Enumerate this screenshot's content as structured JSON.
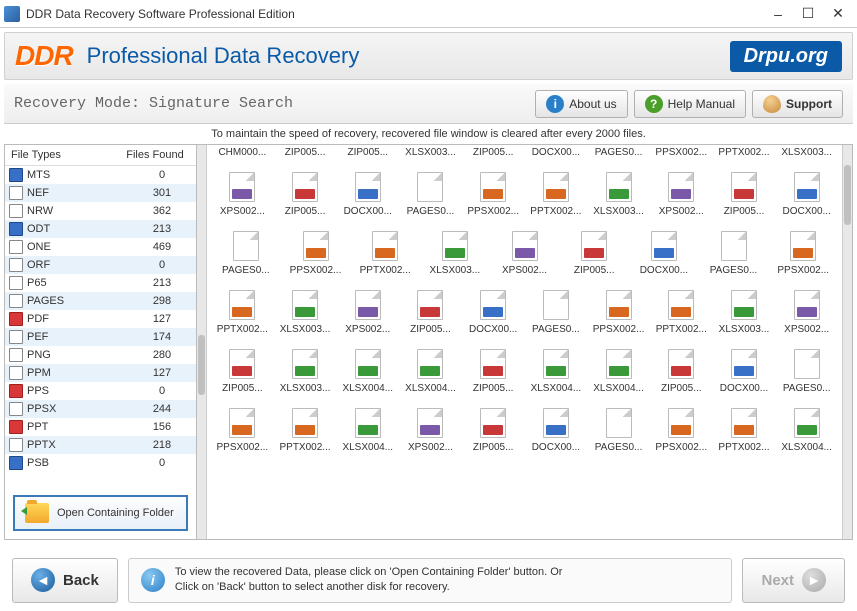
{
  "window": {
    "title": "DDR Data Recovery Software Professional Edition"
  },
  "banner": {
    "logo": "DDR",
    "title": "Professional Data Recovery",
    "brand": "Drpu.org"
  },
  "toolbar": {
    "mode": "Recovery Mode: Signature Search",
    "about": "About us",
    "help": "Help Manual",
    "support": "Support"
  },
  "info_strip": "To maintain the speed of recovery, recovered file window is cleared after every 2000 files.",
  "filetypes": {
    "col1": "File Types",
    "col2": "Files Found",
    "rows": [
      {
        "name": "MTS",
        "count": "0",
        "ic": "blue"
      },
      {
        "name": "NEF",
        "count": "301",
        "ic": ""
      },
      {
        "name": "NRW",
        "count": "362",
        "ic": ""
      },
      {
        "name": "ODT",
        "count": "213",
        "ic": "blue"
      },
      {
        "name": "ONE",
        "count": "469",
        "ic": ""
      },
      {
        "name": "ORF",
        "count": "0",
        "ic": ""
      },
      {
        "name": "P65",
        "count": "213",
        "ic": ""
      },
      {
        "name": "PAGES",
        "count": "298",
        "ic": ""
      },
      {
        "name": "PDF",
        "count": "127",
        "ic": "red"
      },
      {
        "name": "PEF",
        "count": "174",
        "ic": ""
      },
      {
        "name": "PNG",
        "count": "280",
        "ic": ""
      },
      {
        "name": "PPM",
        "count": "127",
        "ic": ""
      },
      {
        "name": "PPS",
        "count": "0",
        "ic": "red"
      },
      {
        "name": "PPSX",
        "count": "244",
        "ic": ""
      },
      {
        "name": "PPT",
        "count": "156",
        "ic": "red"
      },
      {
        "name": "PPTX",
        "count": "218",
        "ic": ""
      },
      {
        "name": "PSB",
        "count": "0",
        "ic": "blue"
      }
    ]
  },
  "open_folder": "Open Containing Folder",
  "grid": {
    "top": [
      "CHM000...",
      "ZIP005...",
      "ZIP005...",
      "XLSX003...",
      "ZIP005...",
      "DOCX00...",
      "PAGES0...",
      "PPSX002...",
      "PPTX002...",
      "XLSX003..."
    ],
    "rows": [
      [
        {
          "l": "XPS002...",
          "t": "xps"
        },
        {
          "l": "ZIP005...",
          "t": "zip"
        },
        {
          "l": "DOCX00...",
          "t": "doc"
        },
        {
          "l": "PAGES0...",
          "t": ""
        },
        {
          "l": "PPSX002...",
          "t": "ppt"
        },
        {
          "l": "PPTX002...",
          "t": "ppt"
        },
        {
          "l": "XLSX003...",
          "t": "xls"
        },
        {
          "l": "XPS002...",
          "t": "xps"
        },
        {
          "l": "ZIP005...",
          "t": "zip"
        },
        {
          "l": "DOCX00...",
          "t": "doc"
        }
      ],
      [
        {
          "l": "PAGES0...",
          "t": ""
        },
        {
          "l": "PPSX002...",
          "t": "ppt"
        },
        {
          "l": "PPTX002...",
          "t": "ppt"
        },
        {
          "l": "XLSX003...",
          "t": "xls"
        },
        {
          "l": "XPS002...",
          "t": "xps"
        },
        {
          "l": "ZIP005...",
          "t": "zip"
        },
        {
          "l": "DOCX00...",
          "t": "doc"
        },
        {
          "l": "PAGES0...",
          "t": ""
        },
        {
          "l": "PPSX002...",
          "t": "ppt"
        }
      ],
      [
        {
          "l": "PPTX002...",
          "t": "ppt"
        },
        {
          "l": "XLSX003...",
          "t": "xls"
        },
        {
          "l": "XPS002...",
          "t": "xps"
        },
        {
          "l": "ZIP005...",
          "t": "zip"
        },
        {
          "l": "DOCX00...",
          "t": "doc"
        },
        {
          "l": "PAGES0...",
          "t": ""
        },
        {
          "l": "PPSX002...",
          "t": "ppt"
        },
        {
          "l": "PPTX002...",
          "t": "ppt"
        },
        {
          "l": "XLSX003...",
          "t": "xls"
        },
        {
          "l": "XPS002...",
          "t": "xps"
        }
      ],
      [
        {
          "l": "ZIP005...",
          "t": "zip"
        },
        {
          "l": "XLSX003...",
          "t": "xls"
        },
        {
          "l": "XLSX004...",
          "t": "xls"
        },
        {
          "l": "XLSX004...",
          "t": "xls"
        },
        {
          "l": "ZIP005...",
          "t": "zip"
        },
        {
          "l": "XLSX004...",
          "t": "xls"
        },
        {
          "l": "XLSX004...",
          "t": "xls"
        },
        {
          "l": "ZIP005...",
          "t": "zip"
        },
        {
          "l": "DOCX00...",
          "t": "doc"
        },
        {
          "l": "PAGES0...",
          "t": ""
        }
      ],
      [
        {
          "l": "PPSX002...",
          "t": "ppt"
        },
        {
          "l": "PPTX002...",
          "t": "ppt"
        },
        {
          "l": "XLSX004...",
          "t": "xls"
        },
        {
          "l": "XPS002...",
          "t": "xps"
        },
        {
          "l": "ZIP005...",
          "t": "zip"
        },
        {
          "l": "DOCX00...",
          "t": "doc"
        },
        {
          "l": "PAGES0...",
          "t": ""
        },
        {
          "l": "PPSX002...",
          "t": "ppt"
        },
        {
          "l": "PPTX002...",
          "t": "ppt"
        },
        {
          "l": "XLSX004...",
          "t": "xls"
        }
      ]
    ]
  },
  "footer": {
    "back": "Back",
    "next": "Next",
    "hint1": "To view the recovered Data, please click on 'Open Containing Folder' button. Or",
    "hint2": "Click on 'Back' button to select another disk for recovery."
  }
}
